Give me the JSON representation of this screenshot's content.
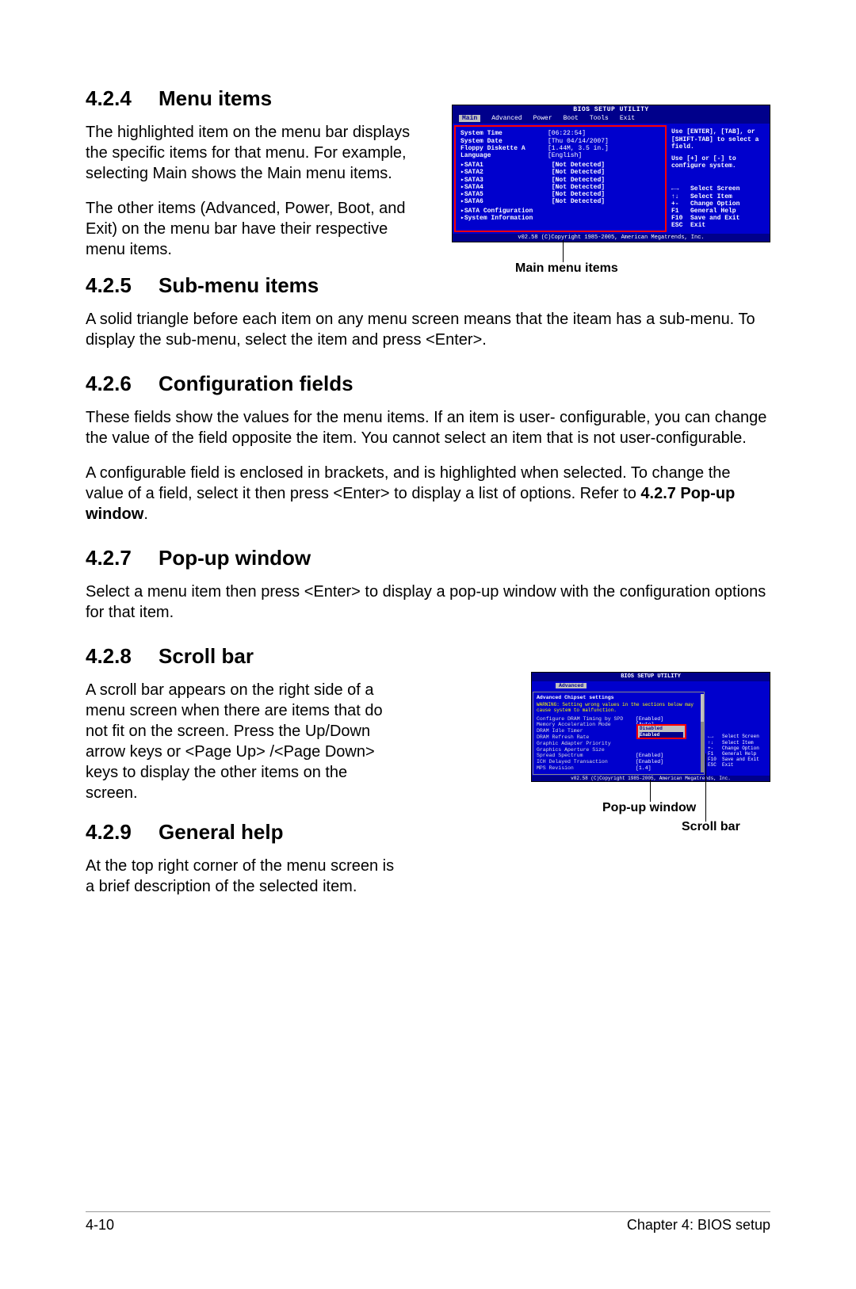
{
  "sections": {
    "s424": {
      "num": "4.2.4",
      "title": "Menu items",
      "p1": "The highlighted item on the menu bar displays the specific items for that menu. For example, selecting Main shows the Main menu items.",
      "p2": "The other items (Advanced, Power, Boot, and Exit) on the menu bar have their respective menu items."
    },
    "s425": {
      "num": "4.2.5",
      "title": "Sub-menu items",
      "p1": "A solid triangle before each item on any menu screen means that the iteam has a sub-menu. To display the sub-menu, select the item and press <Enter>."
    },
    "s426": {
      "num": "4.2.6",
      "title": "Configuration fields",
      "p1": "These fields show the values for the menu items. If an item is user- configurable, you can change the value of the field opposite the item. You cannot select an item that is not user-configurable.",
      "p2": "A configurable field is enclosed in brackets, and is highlighted when selected. To change the value of a field, select it then press <Enter> to display a list of options. Refer to ",
      "p2b": "4.2.7 Pop-up window",
      "p2c": "."
    },
    "s427": {
      "num": "4.2.7",
      "title": "Pop-up window",
      "p1": "Select a menu item then press <Enter> to display a pop-up window with the configuration options for that item."
    },
    "s428": {
      "num": "4.2.8",
      "title": "Scroll bar",
      "p1": "A scroll bar appears on the right side of a menu screen when there are items that do not fit on the screen. Press the Up/Down arrow keys or <Page Up> /<Page Down> keys to display the other items on the screen."
    },
    "s429": {
      "num": "4.2.9",
      "title": "General help",
      "p1": "At the top right corner of the menu screen is a brief description of the selected item."
    }
  },
  "fig1": {
    "title": "BIOS SETUP UTILITY",
    "menus": [
      "Main",
      "Advanced",
      "Power",
      "Boot",
      "Tools",
      "Exit"
    ],
    "selected_menu": "Main",
    "items": [
      {
        "label": "System Time",
        "value": "[06:22:54]"
      },
      {
        "label": "System Date",
        "value": "[Thu 04/14/2007]"
      },
      {
        "label": "Floppy Diskette A",
        "value": "[1.44M, 3.5 in.]"
      },
      {
        "label": "Language",
        "value": "[English]"
      }
    ],
    "sata": [
      {
        "label": "SATA1",
        "value": "[Not Detected]"
      },
      {
        "label": "SATA2",
        "value": "[Not Detected]"
      },
      {
        "label": "SATA3",
        "value": "[Not Detected]"
      },
      {
        "label": "SATA4",
        "value": "[Not Detected]"
      },
      {
        "label": "SATA5",
        "value": "[Not Detected]"
      },
      {
        "label": "SATA6",
        "value": "[Not Detected]"
      }
    ],
    "extras": [
      "SATA Configuration",
      "System Information"
    ],
    "help1": "Use [ENTER], [TAB], or [SHIFT-TAB] to select a field.",
    "help2": "Use [+] or [-] to configure system.",
    "hints": [
      {
        "k": "←→",
        "t": "Select Screen"
      },
      {
        "k": "↑↓",
        "t": "Select Item"
      },
      {
        "k": "+-",
        "t": "Change Option"
      },
      {
        "k": "F1",
        "t": "General Help"
      },
      {
        "k": "F10",
        "t": "Save and Exit"
      },
      {
        "k": "ESC",
        "t": "Exit"
      }
    ],
    "footer": "v02.58 (C)Copyright 1985-2005, American Megatrends, Inc.",
    "caption": "Main menu items"
  },
  "fig2": {
    "title": "BIOS SETUP UTILITY",
    "selected_menu": "Advanced",
    "header": "Advanced Chipset settings",
    "warning": "WARNING: Setting wrong values in the sections below may cause system to malfunction.",
    "rows": [
      {
        "l": "Configure DRAM Timing by SPD",
        "v": "[Enabled]"
      },
      {
        "l": "Memory Acceleration Mode",
        "v": "[Auto]"
      },
      {
        "l": "DRAM Idle Timer",
        "v": ""
      },
      {
        "l": "DRAM Refresh Rate",
        "v": ""
      },
      {
        "l": "",
        "v": ""
      },
      {
        "l": "Graphic Adapter Priority",
        "v": ""
      },
      {
        "l": "Graphics Aperture Size",
        "v": ""
      },
      {
        "l": "Spread Spectrum",
        "v": "[Enabled]"
      },
      {
        "l": "",
        "v": ""
      },
      {
        "l": "ICH Delayed Transaction",
        "v": "[Enabled]"
      },
      {
        "l": "",
        "v": ""
      },
      {
        "l": "MPS Revision",
        "v": "[1.4]"
      }
    ],
    "popup": {
      "opt1": "Disabled",
      "opt2": "Enabled"
    },
    "hints": [
      {
        "k": "←→",
        "t": "Select Screen"
      },
      {
        "k": "↑↓",
        "t": "Select Item"
      },
      {
        "k": "+-",
        "t": "Change Option"
      },
      {
        "k": "F1",
        "t": "General Help"
      },
      {
        "k": "F10",
        "t": "Save and Exit"
      },
      {
        "k": "ESC",
        "t": "Exit"
      }
    ],
    "footer": "v02.58 (C)Copyright 1985-2005, American Megatrends, Inc.",
    "caption_popup": "Pop-up window",
    "caption_scroll": "Scroll bar"
  },
  "footer": {
    "left": "4-10",
    "right": "Chapter 4: BIOS setup"
  }
}
